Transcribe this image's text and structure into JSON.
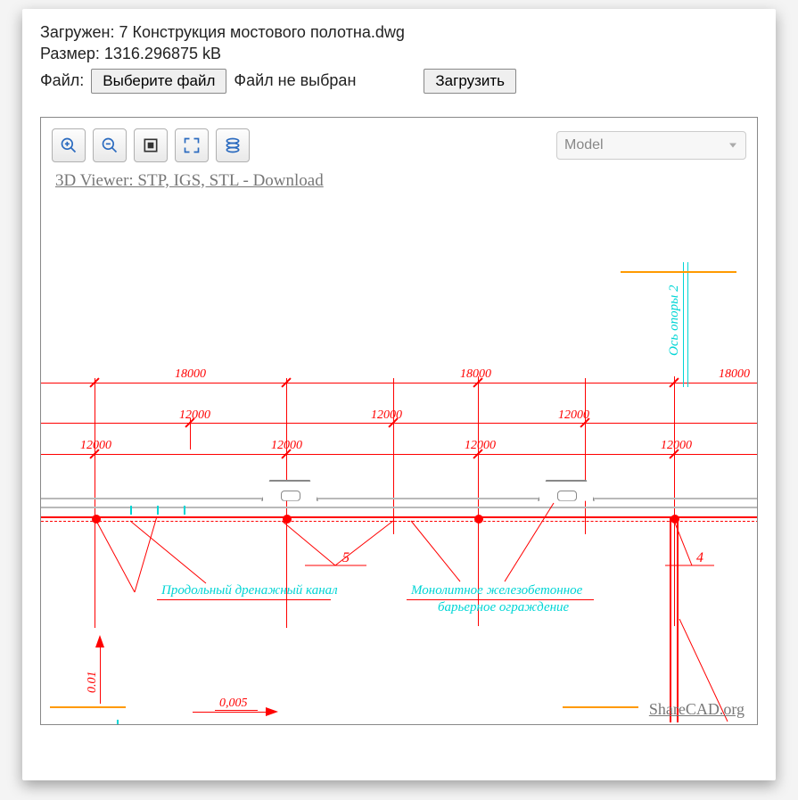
{
  "header": {
    "loaded_label": "Загружен:",
    "loaded_file": "7 Конструкция мостового полотна.dwg",
    "size_label": "Размер:",
    "size_value": "1316.296875 kB",
    "file_label": "Файл:",
    "choose_file_btn": "Выберите файл",
    "no_file_text": "Файл не выбран",
    "upload_btn": "Загрузить"
  },
  "viewer": {
    "promo_link": "3D Viewer: STP, IGS, STL - Download",
    "view_selected": "Model",
    "watermark": "ShareCAD.org"
  },
  "drawing": {
    "dims_top": [
      "18000",
      "18000",
      "18000"
    ],
    "dims_mid": [
      "12000",
      "12000",
      "12000"
    ],
    "dims_low": [
      "12000",
      "12000",
      "12000",
      "12000"
    ],
    "axis_label": "Ось опоры 2",
    "leader_5": "5",
    "leader_4": "4",
    "anno_left": "Продольный дренажный канал",
    "anno_right_1": "Монолитное железобетонное",
    "anno_right_2": "барьерное ограждение",
    "scale_v": "0.01",
    "scale_h": "0,005"
  }
}
